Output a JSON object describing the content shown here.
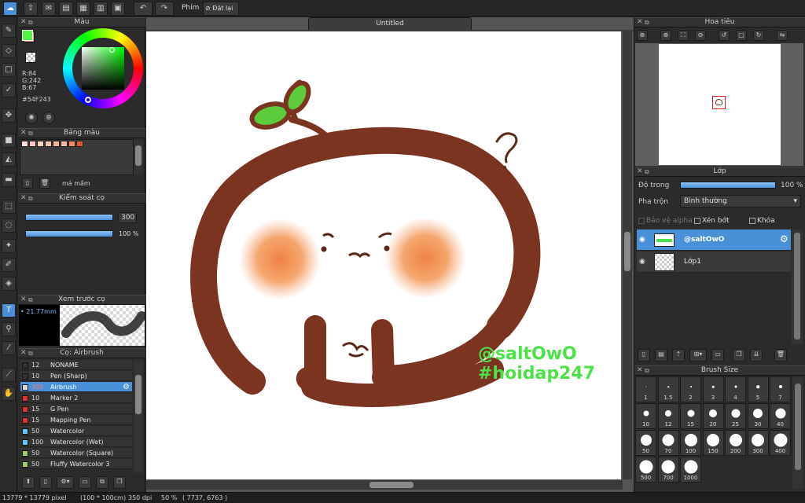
{
  "window": {
    "tab_title": "Untitled"
  },
  "toolbar": {
    "shortcut_label": "Phím",
    "reset_label": "Đặt lại"
  },
  "color_panel": {
    "title": "Màu",
    "r_label": "R:84",
    "g_label": "G:242",
    "b_label": "B:67",
    "hex_label": "#54F243",
    "fg_color": "#54f243",
    "bg_color": "#ff8fa3"
  },
  "palette_panel": {
    "title": "Bảng màu",
    "palette_name": "má mầm",
    "swatches": [
      "#ffe0d8",
      "#ffc8c0",
      "#fcd5c4",
      "#f9c6ad",
      "#f7b89a",
      "#ffb5a3",
      "#f08a60",
      "#dd5a30"
    ]
  },
  "brush_control": {
    "title": "Kiểm soát cọ",
    "size_value": "300",
    "opacity_value": "100 %"
  },
  "brush_preview": {
    "title": "Xem trước cọ",
    "size_label": "• 21.77mm"
  },
  "brush_list": {
    "title": "Cọ: Airbrush",
    "items": [
      {
        "size": "12",
        "name": "NONAME",
        "color": "#333333"
      },
      {
        "size": "10",
        "name": "Pen (Sharp)",
        "color": "#333333"
      },
      {
        "size": "300",
        "name": "Airbrush",
        "color": "#d8d8d8"
      },
      {
        "size": "10",
        "name": "Marker 2",
        "color": "#e53030"
      },
      {
        "size": "15",
        "name": "G Pen",
        "color": "#e53030"
      },
      {
        "size": "15",
        "name": "Mapping Pen",
        "color": "#e53030"
      },
      {
        "size": "50",
        "name": "Watercolor",
        "color": "#5ec8ff"
      },
      {
        "size": "100",
        "name": "Watercolor (Wet)",
        "color": "#5ec8ff"
      },
      {
        "size": "50",
        "name": "Watercolor (Square)",
        "color": "#9ed36a"
      },
      {
        "size": "50",
        "name": "Fluffy Watercolor 3",
        "color": "#9ed36a"
      }
    ]
  },
  "navigator": {
    "title": "Hoa tiêu"
  },
  "layers": {
    "title": "Lớp",
    "opacity_label": "Độ trong",
    "opacity_value": "100 %",
    "blend_label": "Pha trộn",
    "blend_value": "Bình thường",
    "protect_alpha": "Bảo vệ alpha",
    "clipping": "Xén bớt",
    "lock": "Khóa",
    "items": [
      {
        "name": "@saltOwO",
        "selected": true
      },
      {
        "name": "Lớp1",
        "selected": false
      }
    ]
  },
  "brush_size": {
    "title": "Brush Size",
    "sizes": [
      "1",
      "1.5",
      "2",
      "3",
      "4",
      "5",
      "7",
      "10",
      "12",
      "15",
      "20",
      "25",
      "30",
      "40",
      "50",
      "70",
      "100",
      "150",
      "200",
      "300",
      "400",
      "500",
      "700",
      "1000"
    ]
  },
  "canvas": {
    "watermark_line1": "@saltOwO",
    "watermark_line2": "#hoidap247"
  },
  "status_bar": {
    "pixel_size": "13779 * 13779 pixel",
    "physical_size": "(100 * 100cm)",
    "dpi": "350 dpi",
    "zoom": "50 %",
    "coords": "( 7737, 6763 )"
  }
}
